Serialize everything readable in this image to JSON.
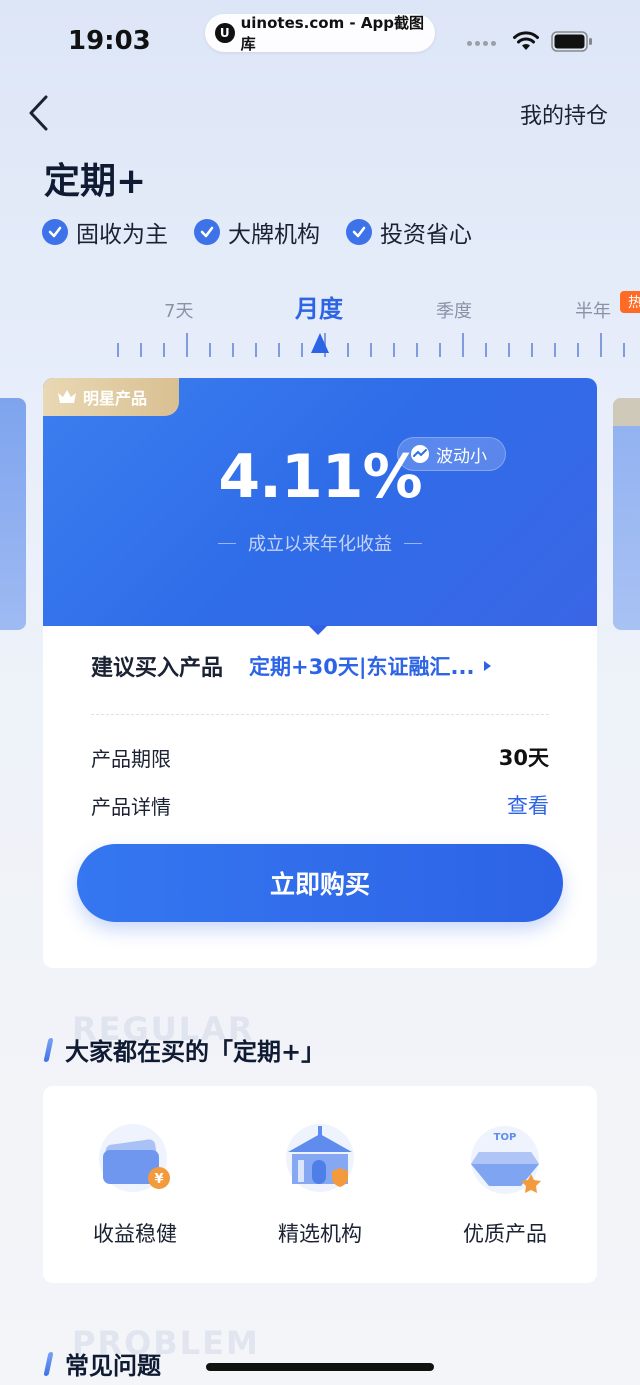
{
  "status_bar": {
    "time": "19:03",
    "watermark_logo": "U",
    "watermark": "uinotes.com - App截图库",
    "icons": [
      "signal-dots-icon",
      "wifi-icon",
      "battery-icon"
    ]
  },
  "nav": {
    "back_icon": "chevron-left-icon",
    "holdings_label": "我的持仓"
  },
  "page_title": "定期+",
  "features": [
    {
      "label": "固收为主",
      "icon": "check-circle-icon"
    },
    {
      "label": "大牌机构",
      "icon": "check-circle-icon"
    },
    {
      "label": "投资省心",
      "icon": "check-circle-icon"
    }
  ],
  "period_tabs": {
    "items": [
      "7天",
      "月度",
      "季度",
      "半年"
    ],
    "selected": "月度",
    "hot_badge": "热"
  },
  "product_card": {
    "badge": "明星产品",
    "rate": "4.11%",
    "volatility": "波动小",
    "rate_caption": "成立以来年化收益",
    "suggest_label": "建议买入产品",
    "suggest_product": "定期+30天|东证融汇...",
    "term_label": "产品期限",
    "term_value": "30天",
    "detail_label": "产品详情",
    "detail_link": "查看",
    "buy_button": "立即购买"
  },
  "popular_section": {
    "bg_text": "REGULAR",
    "title": "大家都在买的「定期+」",
    "items": [
      {
        "label": "收益稳健",
        "icon": "wallet-yen-icon"
      },
      {
        "label": "精选机构",
        "icon": "institution-shield-icon"
      },
      {
        "label": "优质产品",
        "icon": "top-diamond-icon",
        "icon_text": "TOP"
      }
    ]
  },
  "faq_section": {
    "bg_text": "PROBLEM",
    "title": "常见问题"
  },
  "colors": {
    "accent": "#2d64e6",
    "hero_blue": "#3c7ff0",
    "hot": "#ff6a24",
    "gold": "#d9c092"
  }
}
